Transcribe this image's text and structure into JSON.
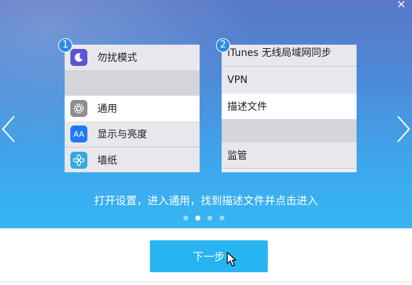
{
  "close_glyph": "×",
  "panel1": {
    "badge": "1",
    "items": [
      {
        "label": "勿扰模式",
        "icon": "moon-icon"
      },
      {
        "label": "通用",
        "icon": "gear-icon"
      },
      {
        "label": "显示与亮度",
        "icon": "display-brightness-icon",
        "icon_text": "AA"
      },
      {
        "label": "墙纸",
        "icon": "wallpaper-flower-icon"
      }
    ]
  },
  "panel2": {
    "badge": "2",
    "items": [
      {
        "label": "iTunes 无线局域网同步"
      },
      {
        "label": "VPN"
      },
      {
        "label": "描述文件"
      },
      {
        "label": "监管"
      }
    ]
  },
  "caption": "打开设置，进入通用，找到描述文件并点击进入",
  "pagination": {
    "count": 4,
    "active_index": 1
  },
  "next_button_label": "下一步",
  "colors": {
    "accent": "#27b4f0",
    "hero_top": "#5a78c6",
    "hero_bottom": "#35b6f3",
    "badge": "#2d8ee0",
    "moon_icon_bg": "#5856d6",
    "gear_icon_bg": "#8e8e93",
    "display_icon_bg": "#1e7cf2",
    "wallpaper_icon_bg": "#34aadc"
  }
}
